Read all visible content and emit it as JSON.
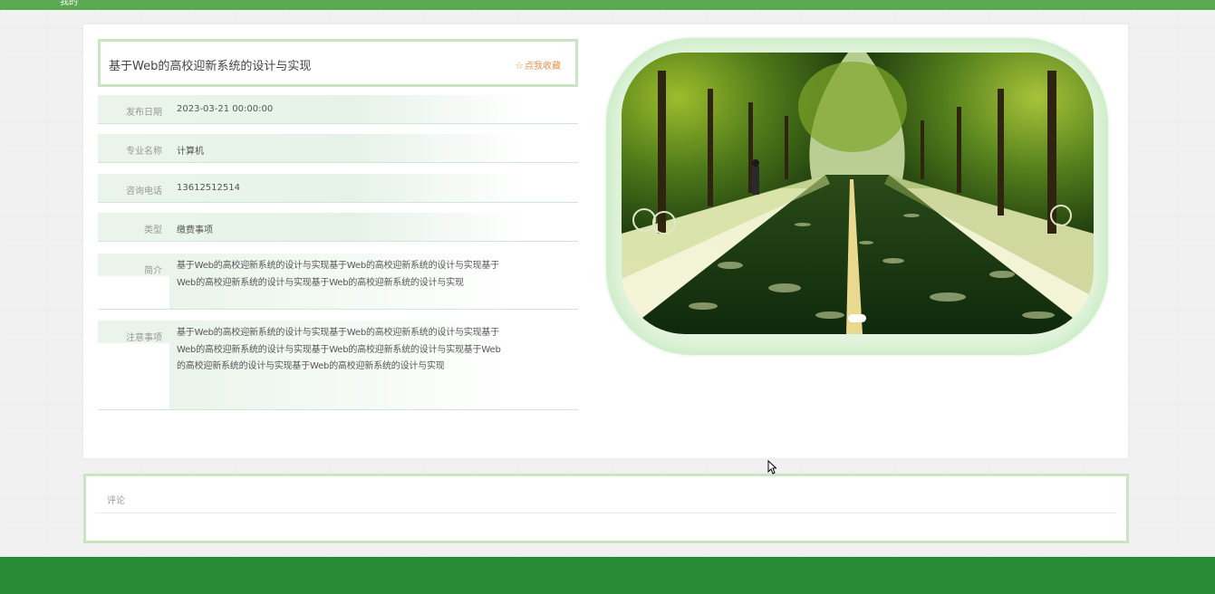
{
  "header": {
    "title_fragment": "我的"
  },
  "detail": {
    "title": "基于Web的高校迎新系统的设计与实现",
    "favorite_label": "点我收藏",
    "favorite_icon": "star-outline-icon",
    "fields": [
      {
        "label": "发布日期",
        "value": "2023-03-21 00:00:00"
      },
      {
        "label": "专业名称",
        "value": "计算机"
      },
      {
        "label": "咨询电话",
        "value": "13612512514"
      },
      {
        "label": "类型",
        "value": "缴费事项"
      },
      {
        "label": "简介",
        "value": "基于Web的高校迎新系统的设计与实现基于Web的高校迎新系统的设计与实现基于Web的高校迎新系统的设计与实现基于Web的高校迎新系统的设计与实现"
      },
      {
        "label": "注意事项",
        "value": "基于Web的高校迎新系统的设计与实现基于Web的高校迎新系统的设计与实现基于Web的高校迎新系统的设计与实现基于Web的高校迎新系统的设计与实现基于Web的高校迎新系统的设计与实现基于Web的高校迎新系统的设计与实现"
      }
    ]
  },
  "carousel": {
    "image": "tree-lined-campus-road-photo",
    "active_slide": 1,
    "total_slides": 1
  },
  "comments": {
    "title": "评论"
  },
  "colors": {
    "top_bar": "#5aa84f",
    "footer": "#278b36",
    "accent_border": "#c8e6c2",
    "favorite": "#e8934a"
  }
}
